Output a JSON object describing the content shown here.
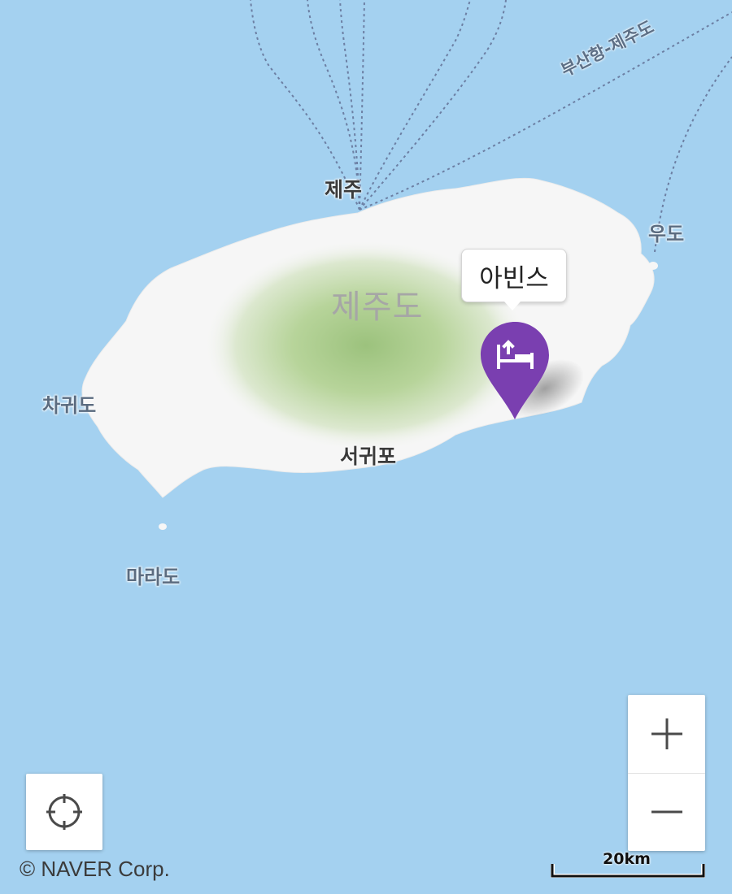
{
  "map": {
    "water_color": "#a4d1f0",
    "land_color": "#f6f6f6",
    "mountain_color": "#9cc27d",
    "ferry_route_color": "#6c7fa3"
  },
  "labels": {
    "jeju_city": "제주",
    "jeju_island": "제주도",
    "seogwipo": "서귀포",
    "chagwido": "차귀도",
    "marado": "마라도",
    "udo": "우도",
    "ferry_route": "부산항-제주도"
  },
  "marker": {
    "name": "아빈스",
    "icon": "bed-icon",
    "color": "#7a3fb0"
  },
  "controls": {
    "locate_icon": "crosshair-icon",
    "zoom_in_icon": "plus-icon",
    "zoom_out_icon": "minus-icon"
  },
  "footer": {
    "copyright": "© NAVER Corp.",
    "scale_label": "20km"
  }
}
